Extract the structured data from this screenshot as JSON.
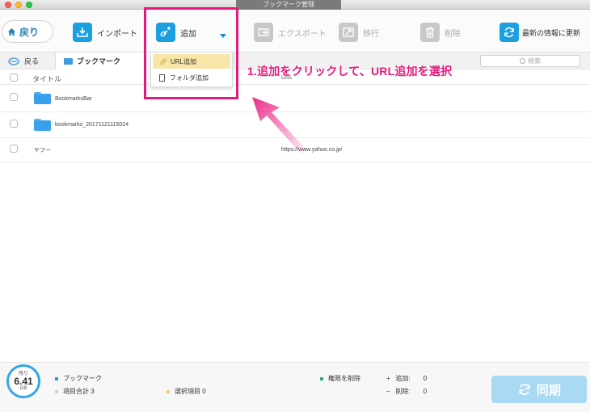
{
  "window": {
    "title": "ブックマーク管理"
  },
  "toolbar": {
    "back_label": "戻り",
    "import_label": "インポート",
    "add_label": "追加",
    "export_label": "エクスポート",
    "move_label": "移行",
    "delete_label": "削除",
    "refresh_label": "最新の情報に更新"
  },
  "crumbs": {
    "back_label": "戻る",
    "current_label": "ブックマーク",
    "search_placeholder": "検索"
  },
  "table": {
    "headers": {
      "title": "タイトル",
      "url": "URL"
    },
    "rows": [
      {
        "name": "BookmarksBar",
        "url": "",
        "type": "folder"
      },
      {
        "name": "bookmarks_20171121115024",
        "url": "",
        "type": "folder"
      },
      {
        "name": "ヤフー",
        "url": "https://www.yahoo.co.jp/",
        "type": "link"
      }
    ]
  },
  "dropdown": {
    "items": [
      {
        "label": "URL追加"
      },
      {
        "label": "フォルダ追加"
      }
    ]
  },
  "annotation": {
    "text": "1.追加をクリックして、URL追加を選択",
    "color": "#e8177d"
  },
  "status": {
    "remaining_label": "残り",
    "capacity_value": "6.41",
    "capacity_unit": "GB",
    "bookmark_label": "ブックマーク",
    "total_label": "項目合計",
    "total_value": "3",
    "selected_label": "選択項目",
    "selected_value": "0",
    "perm_delete_label": "権限を削除",
    "add_sign": "+",
    "add_label": "追加:",
    "add_value": "0",
    "del_sign": "−",
    "del_label": "削除:",
    "del_value": "0",
    "sync_label": "同期"
  },
  "colors": {
    "accent": "#1a9fe0",
    "highlight": "#e8177d",
    "menu_selected": "#f8e6a8"
  }
}
